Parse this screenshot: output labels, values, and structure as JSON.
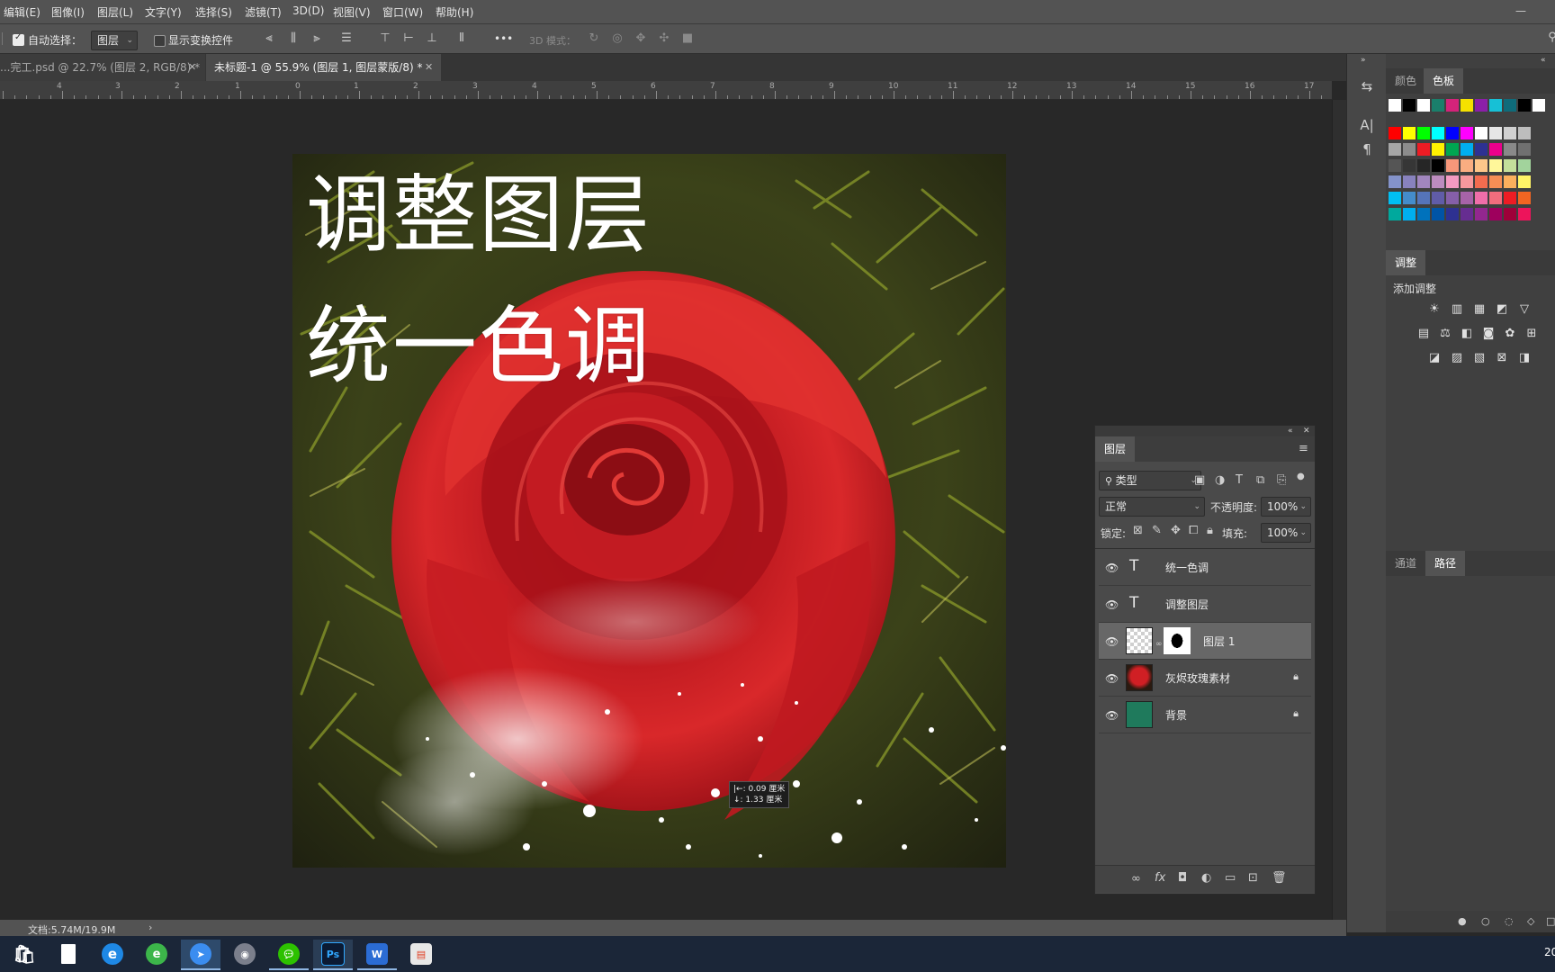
{
  "menu": [
    "编辑(E)",
    "图像(I)",
    "图层(L)",
    "文字(Y)",
    "选择(S)",
    "滤镜(T)",
    "3D(D)",
    "视图(V)",
    "窗口(W)",
    "帮助(H)"
  ],
  "options": {
    "auto_select_label": "自动选择：",
    "auto_select_value": "图层",
    "show_transform_label": "显示变换控件",
    "mode_3d_label": "3D 模式：",
    "more_label": "•••"
  },
  "tabs": [
    {
      "label": "...完工.psd @ 22.7% (图层 2, RGB/8) *",
      "active": false
    },
    {
      "label": "未标题-1 @ 55.9% (图层 1, 图层蒙版/8) *",
      "active": true
    }
  ],
  "ruler_labels": [
    "4",
    "3",
    "2",
    "1",
    "0",
    "1",
    "2",
    "3",
    "4",
    "5",
    "6",
    "7",
    "8",
    "9",
    "10",
    "11",
    "12",
    "13",
    "14",
    "15",
    "16",
    "17"
  ],
  "artwork": {
    "title_line1": "调整图层",
    "title_line2": "统一色调",
    "measure_w": "|←: 0.09 厘米",
    "measure_h": "↓: 1.33 厘米"
  },
  "status": {
    "doc_info": "文档:5.74M/19.9M"
  },
  "swatches_panel": {
    "tab_color": "颜色",
    "tab_swatches": "色板",
    "top_row": [
      "#ffffff",
      "#000000",
      "#ffffff",
      "#1a7f6b",
      "#d4237a",
      "#f5e100",
      "#8b1fa8",
      "#17c0d6",
      "#0f6b7a",
      "#000000",
      "#ffffff"
    ],
    "rows": [
      [
        "#ff0000",
        "#ffff00",
        "#00ff00",
        "#00ffff",
        "#0000ff",
        "#ff00ff",
        "#ffffff",
        "#e6e6e6",
        "#d0d0d0",
        "#bdbdbd"
      ],
      [
        "#a6a6a6",
        "#8c8c8c",
        "#ed1c24",
        "#fff200",
        "#00a651",
        "#00aeef",
        "#2e3192",
        "#ec008c",
        "#898989",
        "#707070"
      ],
      [
        "#555555",
        "#363636",
        "#262626",
        "#000000",
        "#f7977a",
        "#f9ad81",
        "#fdc68a",
        "#fff79a",
        "#c4df9b",
        "#a2d39c"
      ],
      [
        "#8493ca",
        "#8882be",
        "#a186be",
        "#bd8cbf",
        "#f49ac2",
        "#f6989d",
        "#f26c4f",
        "#f68e55",
        "#fbaf5d",
        "#fff467"
      ],
      [
        "#00bff3",
        "#448ccb",
        "#5574b9",
        "#605ca8",
        "#855fa8",
        "#a763a8",
        "#f06ea9",
        "#f26d7d",
        "#ed1c24",
        "#f26522"
      ],
      [
        "#00a99d",
        "#00aeef",
        "#0072bc",
        "#0054a6",
        "#2e3192",
        "#662d91",
        "#92278f",
        "#9e005d",
        "#9e0039",
        "#ed145b"
      ]
    ]
  },
  "adjust_panel": {
    "tab": "调整",
    "add_label": "添加调整"
  },
  "channels_panel": {
    "tab_channels": "通道",
    "tab_paths": "路径"
  },
  "layers_panel": {
    "tab": "图层",
    "filter_kind": "类型",
    "blend_mode": "正常",
    "opacity_label": "不透明度:",
    "opacity_value": "100%",
    "lock_label": "锁定:",
    "fill_label": "填充:",
    "fill_value": "100%",
    "layers": [
      {
        "name": "统一色调",
        "kind": "text"
      },
      {
        "name": "调整图层",
        "kind": "text"
      },
      {
        "name": "图层 1",
        "kind": "masked",
        "selected": true
      },
      {
        "name": "灰烬玫瑰素材",
        "kind": "smart",
        "locked": true
      },
      {
        "name": "背景",
        "kind": "fill",
        "color": "#1f7a5c",
        "locked": true
      }
    ]
  },
  "taskbar": {
    "apps": [
      "store-app",
      "file-app",
      "ie-browser",
      "green-browser",
      "feishu-app",
      "avatar-app",
      "wechat-app",
      "photoshop-app",
      "wps-app",
      "office-app"
    ],
    "ps_label": "Ps",
    "clock_partial": "20"
  }
}
